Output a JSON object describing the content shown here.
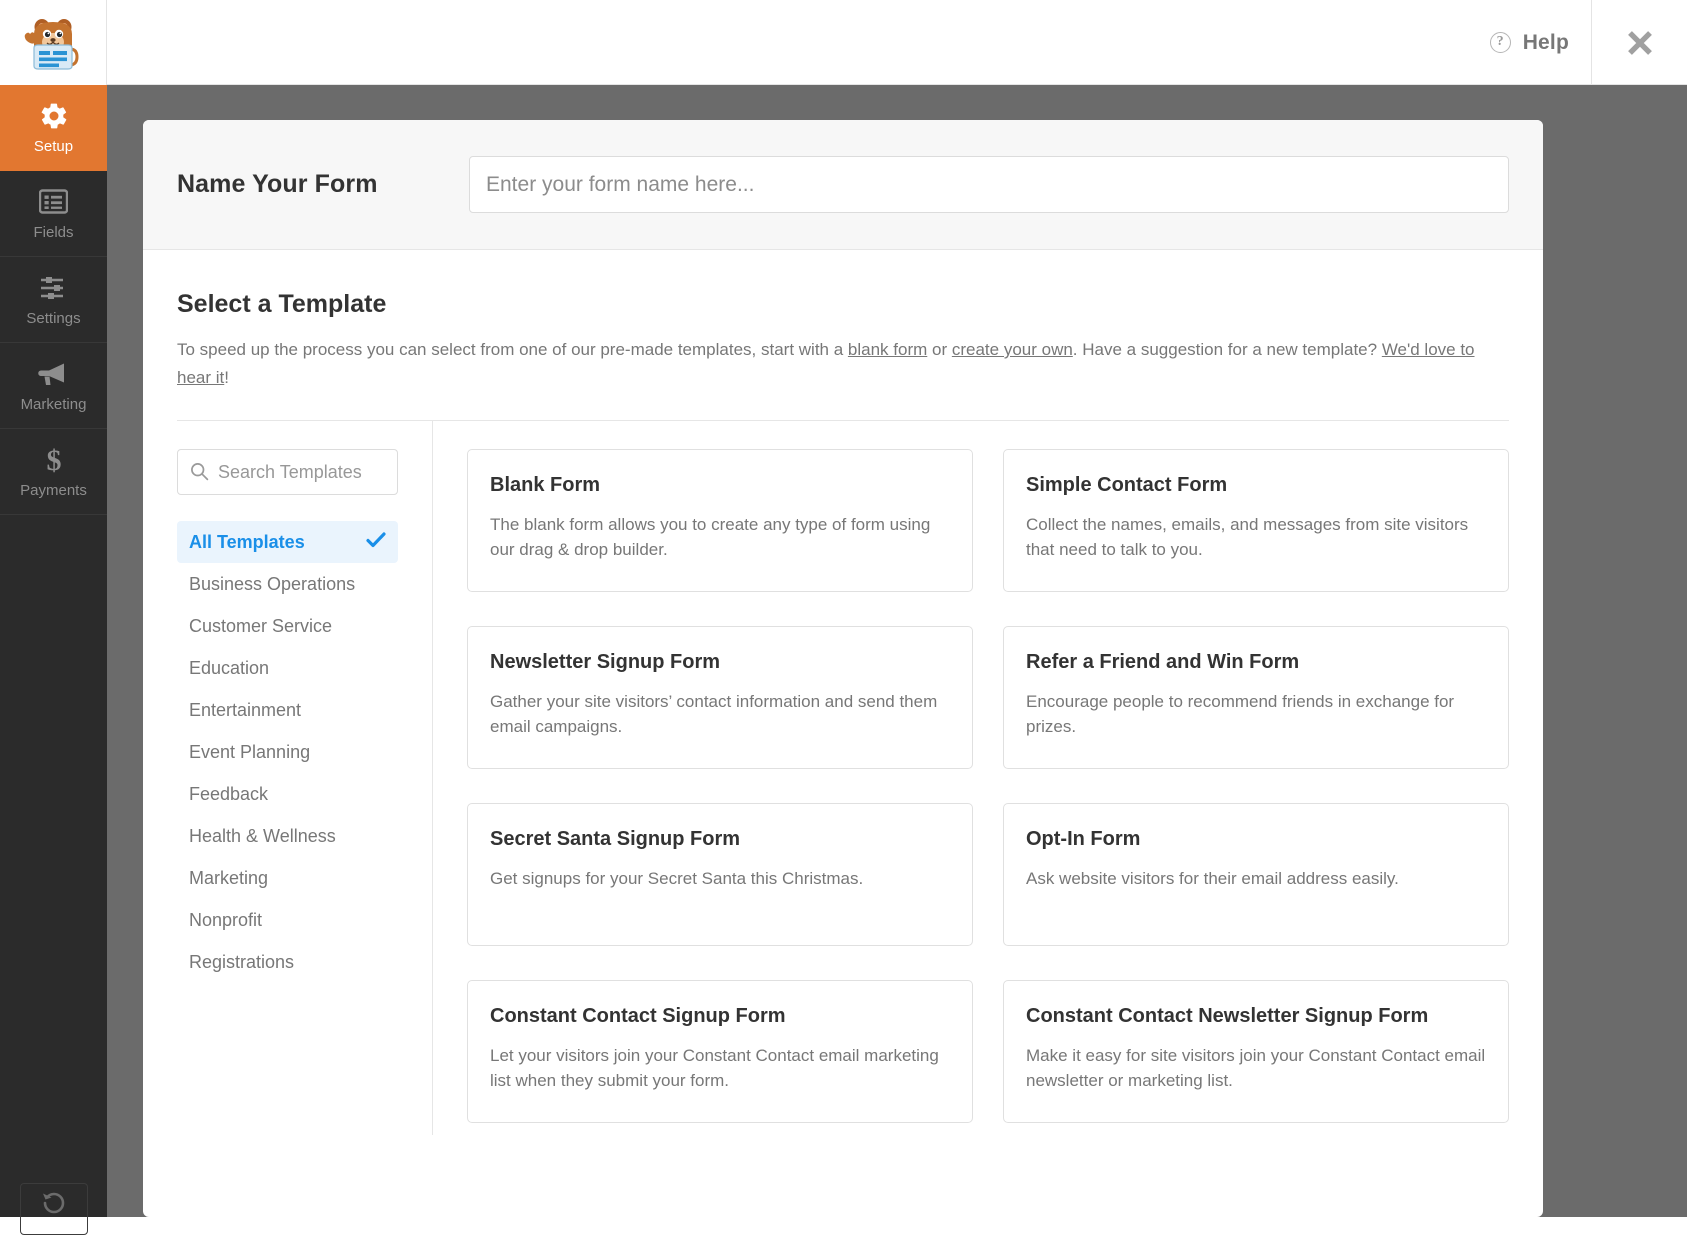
{
  "topbar": {
    "logo_name": "wpforms-mascot-logo",
    "help_label": "Help",
    "help_icon": "question-circle-icon",
    "close_icon": "close-icon"
  },
  "sidebar": {
    "items": [
      {
        "label": "Setup",
        "icon": "gear-icon",
        "active": true
      },
      {
        "label": "Fields",
        "icon": "list-icon",
        "active": false
      },
      {
        "label": "Settings",
        "icon": "sliders-icon",
        "active": false
      },
      {
        "label": "Marketing",
        "icon": "megaphone-icon",
        "active": false
      },
      {
        "label": "Payments",
        "icon": "dollar-sign-icon",
        "active": false
      }
    ]
  },
  "form_name": {
    "label": "Name Your Form",
    "value": "",
    "placeholder": "Enter your form name here..."
  },
  "template_section": {
    "title": "Select a Template",
    "desc_part1": "To speed up the process you can select from one of our pre-made templates, start with a ",
    "link_blank": "blank form",
    "desc_part2": " or ",
    "link_create": "create your own",
    "desc_part3": ". Have a suggestion for a new template? ",
    "link_suggest": "We'd love to hear it",
    "desc_part4": "!"
  },
  "search": {
    "placeholder": "Search Templates",
    "value": "",
    "icon": "search-icon"
  },
  "categories": [
    {
      "label": "All Templates",
      "selected": true
    },
    {
      "label": "Business Operations",
      "selected": false
    },
    {
      "label": "Customer Service",
      "selected": false
    },
    {
      "label": "Education",
      "selected": false
    },
    {
      "label": "Entertainment",
      "selected": false
    },
    {
      "label": "Event Planning",
      "selected": false
    },
    {
      "label": "Feedback",
      "selected": false
    },
    {
      "label": "Health & Wellness",
      "selected": false
    },
    {
      "label": "Marketing",
      "selected": false
    },
    {
      "label": "Nonprofit",
      "selected": false
    },
    {
      "label": "Registrations",
      "selected": false
    }
  ],
  "templates": [
    {
      "title": "Blank Form",
      "desc": "The blank form allows you to create any type of form using our drag & drop builder."
    },
    {
      "title": "Simple Contact Form",
      "desc": "Collect the names, emails, and messages from site visitors that need to talk to you."
    },
    {
      "title": "Newsletter Signup Form",
      "desc": "Gather your site visitors’ contact information and send them email campaigns."
    },
    {
      "title": "Refer a Friend and Win Form",
      "desc": "Encourage people to recommend friends in exchange for prizes."
    },
    {
      "title": "Secret Santa Signup Form",
      "desc": "Get signups for your Secret Santa this Christmas."
    },
    {
      "title": "Opt-In Form",
      "desc": "Ask website visitors for their email address easily."
    },
    {
      "title": "Constant Contact Signup Form",
      "desc": "Let your visitors join your Constant Contact email marketing list when they submit your form."
    },
    {
      "title": "Constant Contact Newsletter Signup Form",
      "desc": "Make it easy for site visitors join your Constant Contact email newsletter or marketing list."
    }
  ],
  "colors": {
    "accent_orange": "#e27730",
    "sidebar_dark": "#2b2b2b",
    "link_blue": "#1a8fe8",
    "selected_bg": "#eaf4fd",
    "overlay": "#6b6b6b"
  }
}
